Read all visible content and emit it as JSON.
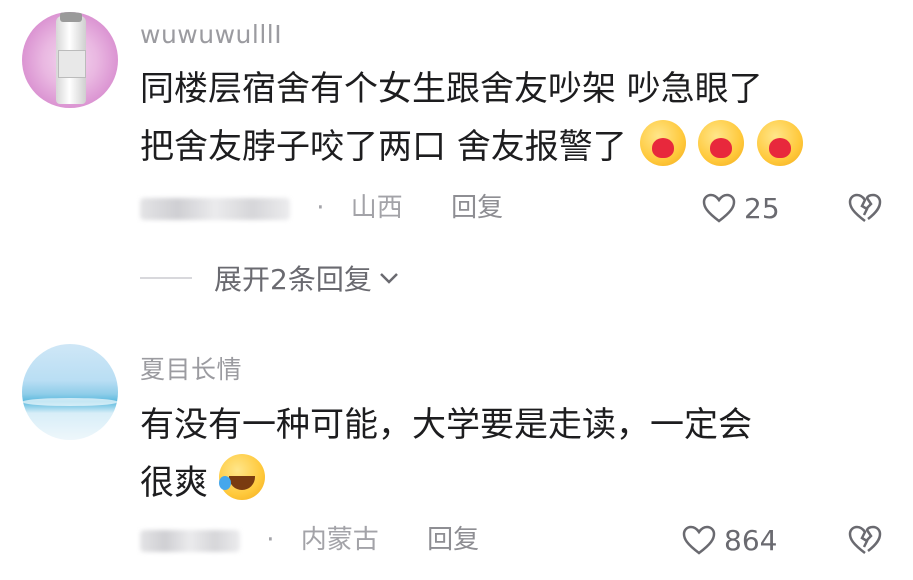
{
  "comments": [
    {
      "username": "wuwuwulllI",
      "text_line1": "同楼层宿舍有个女生跟舍友吵架 吵急眼了",
      "text_line2": "把舍友脖子咬了两口 舍友报警了",
      "location": "山西",
      "reply_label": "回复",
      "likes": "25",
      "avatar_icon": "bottle-avatar-icon",
      "reaction_icon": "heart-face-emoji-icon",
      "expand_label": "展开2条回复"
    },
    {
      "username": "夏目长情",
      "text_line1": "有没有一种可能，大学要是走读，一定会",
      "text_line2": "很爽",
      "location": "内蒙古",
      "reply_label": "回复",
      "likes": "864",
      "avatar_icon": "ocean-avatar-icon",
      "reaction_icon": "laughing-tears-emoji-icon"
    }
  ],
  "colors": {
    "text": "#1d1d1f",
    "meta": "#a3a3a8",
    "username": "#9b9ba0",
    "reaction": "#e8283c"
  }
}
